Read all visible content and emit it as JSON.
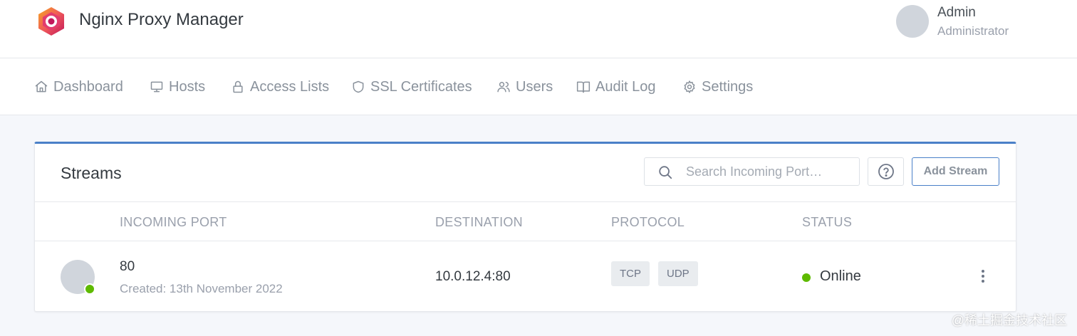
{
  "header": {
    "brand": "Nginx Proxy Manager",
    "user_name": "Admin",
    "user_role": "Administrator"
  },
  "nav": {
    "items": [
      {
        "label": "Dashboard",
        "icon": "home-icon"
      },
      {
        "label": "Hosts",
        "icon": "monitor-icon"
      },
      {
        "label": "Access Lists",
        "icon": "lock-icon"
      },
      {
        "label": "SSL Certificates",
        "icon": "shield-icon"
      },
      {
        "label": "Users",
        "icon": "users-icon"
      },
      {
        "label": "Audit Log",
        "icon": "book-icon"
      },
      {
        "label": "Settings",
        "icon": "gear-icon"
      }
    ]
  },
  "streams": {
    "title": "Streams",
    "search_placeholder": "Search Incoming Port…",
    "help_icon": "help-circle-icon",
    "add_label": "Add Stream",
    "columns": [
      "INCOMING PORT",
      "DESTINATION",
      "PROTOCOL",
      "STATUS"
    ],
    "rows": [
      {
        "port": "80",
        "created": "Created: 13th November 2022",
        "destination": "10.0.12.4:80",
        "protocols": [
          "TCP",
          "UDP"
        ],
        "status": "Online"
      }
    ]
  },
  "colors": {
    "accent": "#4a80c8",
    "online": "#5eba00"
  },
  "watermark": "@稀土掘金技术社区"
}
